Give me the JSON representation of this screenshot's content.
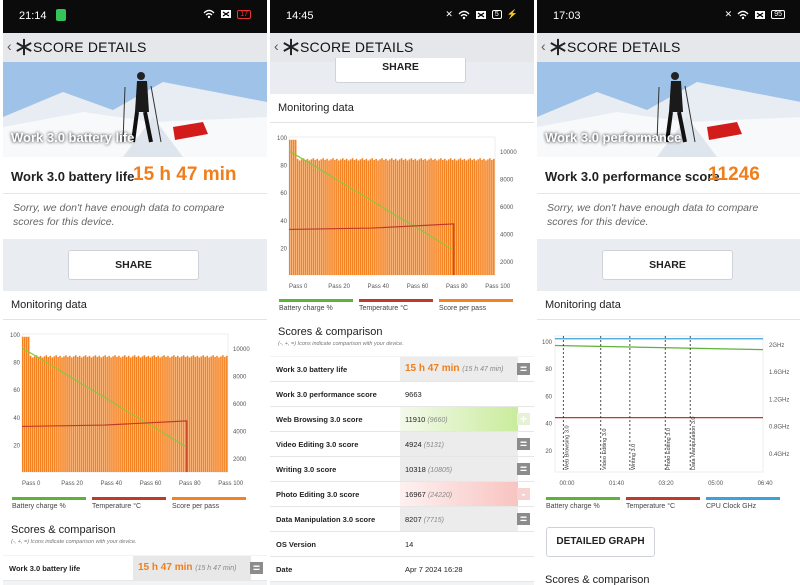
{
  "colors": {
    "accent": "#f07e1b",
    "battery": "#5cb338",
    "temperature": "#c03a2b",
    "score": "#f58220",
    "cpu": "#3aa3dc",
    "betterBg": "#c9ec9c",
    "worseBg": "#f8c4c1"
  },
  "common": {
    "title": "SCORE DETAILS",
    "share": "SHARE",
    "sorry": "Sorry, we don't have enough data to compare scores for this device.",
    "monitoring": "Monitoring data",
    "scores_heading": "Scores & comparison",
    "scores_hint": "(-, +, =) Icons indicate comparison with your device."
  },
  "panel1": {
    "time": "21:14",
    "battery": "17",
    "hero_text": "Work 3.0 battery life",
    "score_label": "Work 3.0 battery life",
    "score_value": "15 h 47 min",
    "chart_left_ticks": [
      "100",
      "80",
      "60",
      "40",
      "20"
    ],
    "chart_right_ticks": [
      "10000",
      "8000",
      "6000",
      "4000",
      "2000"
    ],
    "chart_x_ticks": [
      "Pass 0",
      "Pass 20",
      "Pass 40",
      "Pass 60",
      "Pass 80",
      "Pass 100"
    ],
    "legend": [
      "Battery charge %",
      "Temperature °C",
      "Score per pass"
    ],
    "row": {
      "label": "Work 3.0 battery life",
      "value": "15 h 47 min",
      "compare": "(15 h 47 min)",
      "icon": "="
    }
  },
  "panel2": {
    "time": "14:45",
    "battery": "5",
    "chart_left_ticks": [
      "100",
      "80",
      "60",
      "40",
      "20"
    ],
    "chart_right_ticks": [
      "10000",
      "8000",
      "6000",
      "4000",
      "2000"
    ],
    "chart_x_ticks": [
      "Pass 0",
      "Pass 20",
      "Pass 40",
      "Pass 60",
      "Pass 80",
      "Pass 100"
    ],
    "legend": [
      "Battery charge %",
      "Temperature °C",
      "Score per pass"
    ],
    "rows": [
      {
        "label": "Work 3.0 battery life",
        "value": "15 h 47 min",
        "compare": "(15 h 47 min)",
        "icon": "="
      },
      {
        "label": "Work 3.0 performance score",
        "value": "9663",
        "compare": "",
        "icon": ""
      },
      {
        "label": "Web Browsing 3.0 score",
        "value": "11910",
        "compare": "(9660)",
        "icon": "+"
      },
      {
        "label": "Video Editing 3.0 score",
        "value": "4924",
        "compare": "(5131)",
        "icon": "="
      },
      {
        "label": "Writing 3.0 score",
        "value": "10318",
        "compare": "(10805)",
        "icon": "="
      },
      {
        "label": "Photo Editing 3.0 score",
        "value": "16967",
        "compare": "(24220)",
        "icon": "-"
      },
      {
        "label": "Data Manipulation 3.0 score",
        "value": "8207",
        "compare": "(7715)",
        "icon": "="
      },
      {
        "label": "OS Version",
        "value": "14",
        "compare": "",
        "icon": ""
      },
      {
        "label": "Date",
        "value": "Apr 7 2024 16:28",
        "compare": "",
        "icon": ""
      }
    ]
  },
  "panel3": {
    "time": "17:03",
    "battery": "95",
    "hero_text": "Work 3.0 performance",
    "score_label": "Work 3.0 performance score",
    "score_value": "11246",
    "chart_left_ticks": [
      "100",
      "80",
      "60",
      "40",
      "20"
    ],
    "chart_right_ticks": [
      "2GHz",
      "1.6GHz",
      "1.2GHz",
      "0.8GHz",
      "0.4GHz"
    ],
    "chart_x_ticks": [
      "00:00",
      "01:40",
      "03:20",
      "05:00",
      "06:40"
    ],
    "markers": [
      "Web Browsing 3.0",
      "Video Editing 3.0",
      "Writing 3.0",
      "Photo Editing 3.0",
      "Data Manipulation 3.0"
    ],
    "legend": [
      "Battery charge %",
      "Temperature °C",
      "CPU Clock GHz"
    ],
    "detailed": "DETAILED GRAPH",
    "scores_heading": "Scores & comparison"
  },
  "chart_data": [
    {
      "type": "bar",
      "title": "",
      "x_ticks": [
        "Pass 0",
        "Pass 20",
        "Pass 40",
        "Pass 60",
        "Pass 80",
        "Pass 100"
      ],
      "series": [
        {
          "name": "Score per pass",
          "value_approx": 8400,
          "count": 105
        },
        {
          "name": "Battery charge %",
          "from": [
            0,
            100
          ],
          "to": [
            90,
            18
          ]
        },
        {
          "name": "Temperature °C",
          "approx": 33
        }
      ],
      "y_left": [
        0,
        100
      ],
      "y_right": [
        0,
        10000
      ]
    },
    {
      "type": "line",
      "title": "",
      "x_ticks": [
        "00:00",
        "01:40",
        "03:20",
        "05:00",
        "06:40"
      ],
      "series": [
        {
          "name": "Battery charge %",
          "approx": 94
        },
        {
          "name": "Temperature °C",
          "approx": 38
        },
        {
          "name": "CPU Clock GHz",
          "approx": 2.0
        }
      ],
      "y_left": [
        0,
        100
      ],
      "y_right": [
        0,
        2
      ]
    }
  ]
}
